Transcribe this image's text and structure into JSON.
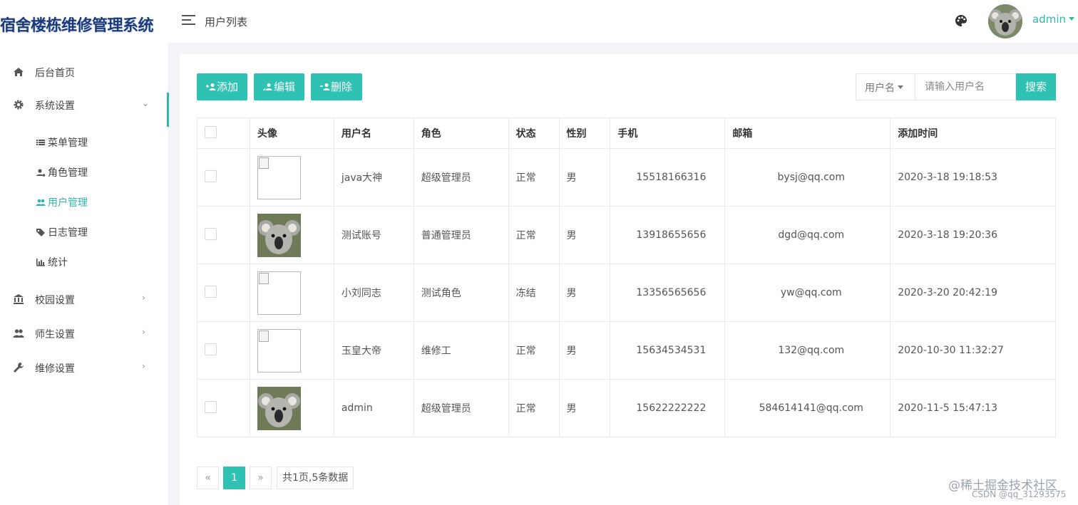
{
  "app": {
    "title": "宿舍楼栋维修管理系统"
  },
  "header": {
    "page_title": "用户列表",
    "user_name": "admin"
  },
  "sidebar": {
    "items": [
      {
        "label": "后台首页",
        "icon": "home-icon"
      },
      {
        "label": "系统设置",
        "icon": "gear-icon",
        "expanded": true,
        "children": [
          {
            "label": "菜单管理",
            "icon": "list-icon"
          },
          {
            "label": "角色管理",
            "icon": "user-role-icon"
          },
          {
            "label": "用户管理",
            "icon": "users-icon",
            "active": true
          },
          {
            "label": "日志管理",
            "icon": "tag-icon"
          },
          {
            "label": "统计",
            "icon": "bar-chart-icon"
          }
        ]
      },
      {
        "label": "校园设置",
        "icon": "bank-icon"
      },
      {
        "label": "师生设置",
        "icon": "people-icon"
      },
      {
        "label": "维修设置",
        "icon": "wrench-icon"
      }
    ]
  },
  "toolbar": {
    "add_label": "添加",
    "edit_label": "编辑",
    "delete_label": "删除"
  },
  "search": {
    "field_label": "用户名",
    "placeholder": "请输入用户名",
    "button_label": "搜索"
  },
  "table": {
    "columns": [
      "",
      "头像",
      "用户名",
      "角色",
      "状态",
      "性别",
      "手机",
      "邮箱",
      "添加时间"
    ],
    "rows": [
      {
        "avatar": "broken",
        "username": "java大神",
        "role": "超级管理员",
        "status": "正常",
        "gender": "男",
        "phone": "15518166316",
        "email": "bysj@qq.com",
        "added": "2020-3-18 19:18:53"
      },
      {
        "avatar": "koala",
        "username": "测试账号",
        "role": "普通管理员",
        "status": "正常",
        "gender": "男",
        "phone": "13918655656",
        "email": "dgd@qq.com",
        "added": "2020-3-18 19:20:36"
      },
      {
        "avatar": "broken",
        "username": "小刘同志",
        "role": "测试角色",
        "status": "冻结",
        "gender": "男",
        "phone": "13356565656",
        "email": "yw@qq.com",
        "added": "2020-3-20 20:42:19"
      },
      {
        "avatar": "broken",
        "username": "玉皇大帝",
        "role": "维修工",
        "status": "正常",
        "gender": "男",
        "phone": "15634534531",
        "email": "132@qq.com",
        "added": "2020-10-30 11:32:27"
      },
      {
        "avatar": "koala",
        "username": "admin",
        "role": "超级管理员",
        "status": "正常",
        "gender": "男",
        "phone": "15622222222",
        "email": "584614141@qq.com",
        "added": "2020-11-5 15:47:13"
      }
    ]
  },
  "pagination": {
    "prev": "«",
    "current": "1",
    "next": "»",
    "info": "共1页,5条数据"
  },
  "watermark": {
    "line1": "@稀土掘金技术社区",
    "line2": "CSDN @qq_31293575"
  },
  "colors": {
    "accent": "#2fc1b1",
    "frozen": "#f0a04b",
    "brand_text": "#1a3a7a"
  }
}
